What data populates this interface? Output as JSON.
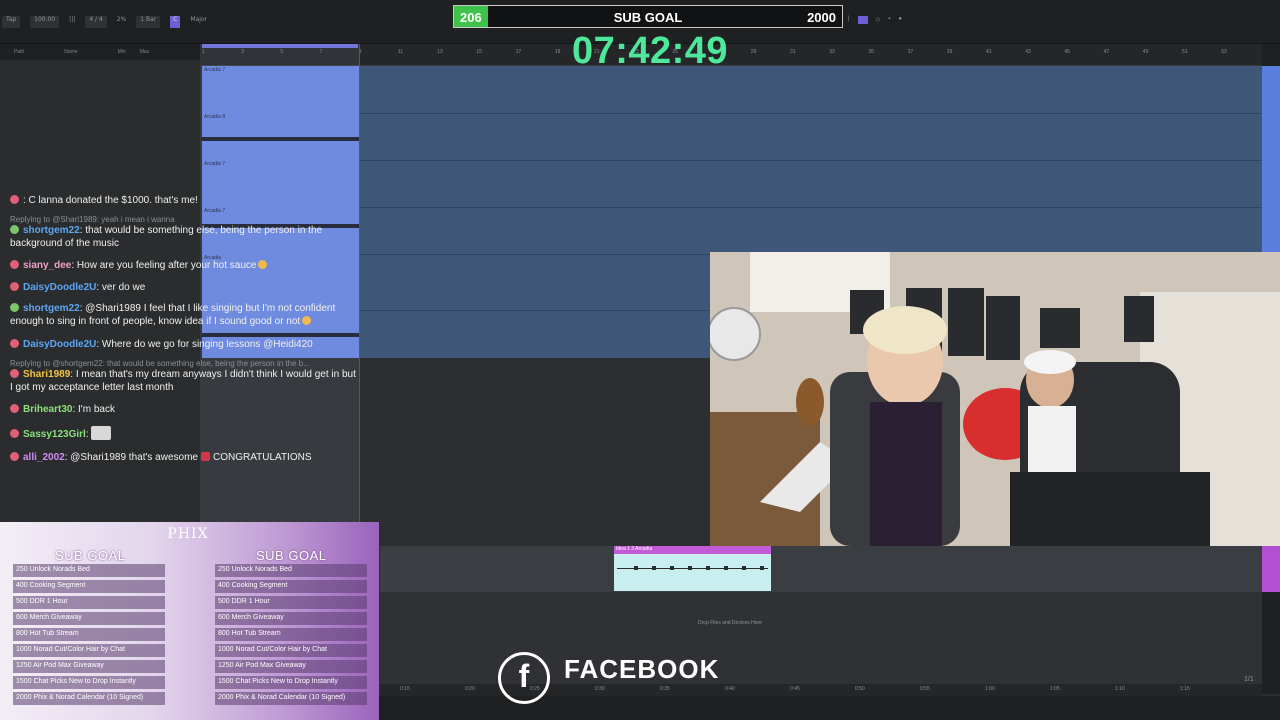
{
  "daw": {
    "transport": [
      "Tap",
      "100.00",
      "|||",
      "4 / 4",
      "2%",
      "1 Bar",
      "C",
      "Major"
    ],
    "columns": [
      "Path",
      "Name",
      "Min",
      "Max"
    ],
    "ruler_ticks": [
      "1",
      "3",
      "5",
      "7",
      "9",
      "11",
      "13",
      "15",
      "17",
      "19",
      "21",
      "23",
      "25",
      "27",
      "29",
      "31",
      "33",
      "35",
      "37",
      "39",
      "41",
      "43",
      "45",
      "47",
      "49",
      "51",
      "53"
    ],
    "clips": [
      {
        "label": "Arcadia 7"
      },
      {
        "label": "Arcadia 8"
      },
      {
        "label": "Arcadia 7"
      },
      {
        "label": "Arcadia 7"
      },
      {
        "label": "Arcadia"
      }
    ],
    "midi_clip_label": "Idea 1 3 Arcadia",
    "drop_hint": "Drop Files and Devices Here",
    "timeline_ticks": [
      "0:15",
      "0:20",
      "0:25",
      "0:30",
      "0:35",
      "0:40",
      "0:45",
      "0:50",
      "0:55",
      "1:00",
      "1:05",
      "1:10",
      "1:15"
    ],
    "page_indicator": "1/1"
  },
  "sub_goal": {
    "current": "206",
    "label": "SUB GOAL",
    "target": "2000",
    "fill_fraction": 0.103
  },
  "timer": "07:42:49",
  "chat": {
    "top_partial": {
      "user": "",
      "text": ": C lanna donated the $1000. that's me!"
    },
    "reply_1": "Replying to @Shari1989: yeah i mean i wanna",
    "messages": [
      {
        "user": "shortgem22",
        "text": ": that would be something else, being the person in the background of the music",
        "color": "#5da7f5",
        "badge": "#7cc56a"
      },
      {
        "user": "siany_dee",
        "text": ": How are you feeling after your hot sauce",
        "color": "#f0a0c8",
        "badge": "#e0607a"
      },
      {
        "user": "DaisyDoodle2U",
        "text": ": ver do we",
        "color": "#5da7f5",
        "badge": "#e0607a"
      },
      {
        "user": "shortgem22",
        "text": ": @Shari1989 I feel that I like singing but I'm not confident enough to sing in front of people, know idea if I sound good or not",
        "color": "#5da7f5",
        "badge": "#7cc56a"
      },
      {
        "user": "DaisyDoodle2U",
        "text": ": Where do we go for singing lessons @Heidi420",
        "color": "#5da7f5",
        "badge": "#e0607a"
      }
    ],
    "reply_2": "Replying to @shortgem22: that would be something else, being the person in the b...",
    "messages_2": [
      {
        "user": "Shari1989",
        "text": ": I mean that's my dream anyways I didn't think I would get in but I got my acceptance letter last month",
        "color": "#f5c542",
        "badge": "#e0607a"
      },
      {
        "user": "Briheart30",
        "text": ": I'm back",
        "color": "#8ee07a",
        "badge": "#e0607a"
      },
      {
        "user": "Sassy123Girl",
        "text": ":",
        "color": "#8ee07a",
        "badge": "#e0607a"
      },
      {
        "user": "alli_2002",
        "text": ": @Shari1989 that's awesome",
        "tail": "CONGRATULATIONS",
        "color": "#d08ef5",
        "badge": "#e0607a"
      }
    ]
  },
  "goal_panel": {
    "title_left": "SUB GOAL",
    "title_right": "SUB GOAL",
    "logo": "PHIX",
    "items": [
      "250 Unlock Norads Bed",
      "400 Cooking Segment",
      "500 DDR 1 Hour",
      "600 Merch Giveaway",
      "800 Hot Tub Stream",
      "1000 Norad Cut/Color Hair by Chat",
      "1250 Air Pod Max Giveaway",
      "1500 Chat Picks New to Drop Instantly",
      "2000 Phix & Norad Calendar (10 Signed)"
    ]
  },
  "watermark": {
    "letter": "f",
    "text": "FACEBOOK"
  },
  "colors": {
    "lane_blue": "#3e5778",
    "clip_blue": "#6b8ae8",
    "goal_green": "#3ec24a",
    "timer_green": "#4ee89a",
    "midi_pink": "#c35bd9"
  }
}
